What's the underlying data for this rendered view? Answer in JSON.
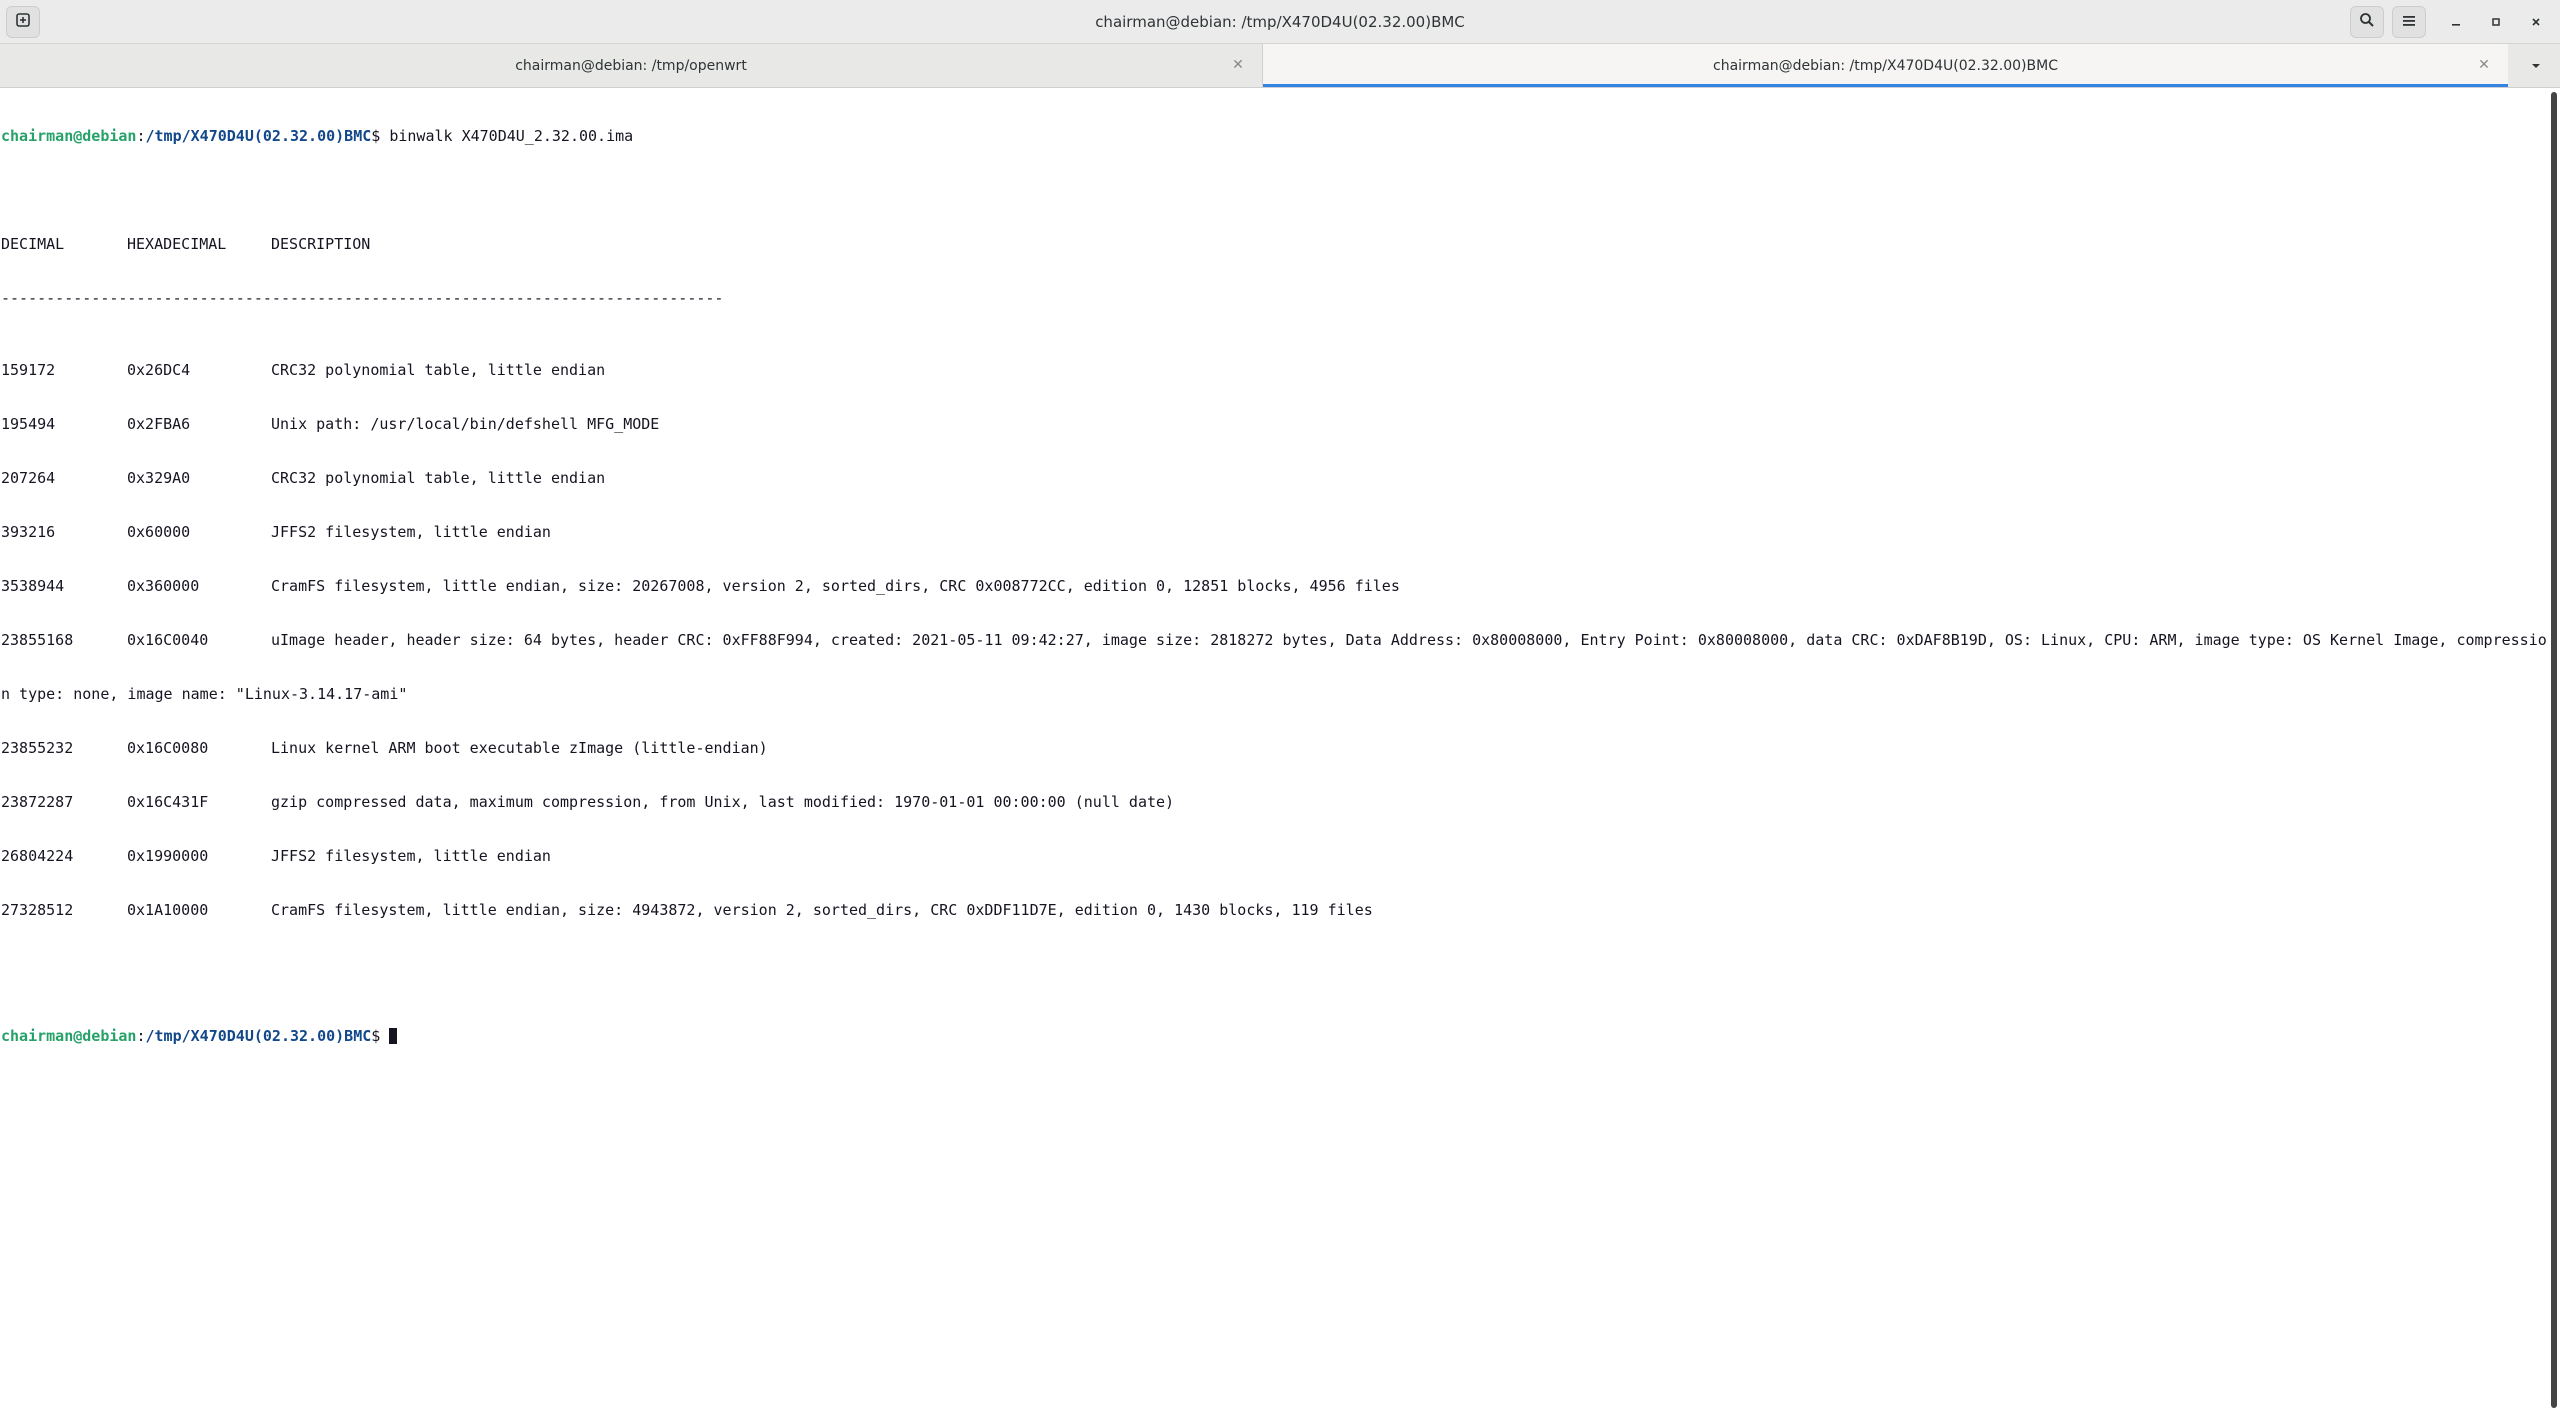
{
  "window": {
    "title": "chairman@debian: /tmp/X470D4U(02.32.00)BMC"
  },
  "header": {
    "new_tab_icon": "new-tab-icon",
    "search_icon": "search-icon",
    "menu_icon": "hamburger-menu-icon"
  },
  "tabs": [
    {
      "label": "chairman@debian: /tmp/openwrt",
      "active": false
    },
    {
      "label": "chairman@debian: /tmp/X470D4U(02.32.00)BMC",
      "active": true
    }
  ],
  "colors": {
    "accent": "#3584e4",
    "prompt_user": "#26a269",
    "prompt_path": "#12488b"
  },
  "terminal": {
    "prompt_user": "chairman@debian",
    "prompt_sep": ":",
    "prompt_path": "/tmp/X470D4U(02.32.00)BMC",
    "prompt_dollar": "$ ",
    "command": "binwalk X470D4U_2.32.00.ima",
    "headers": [
      "DECIMAL",
      "HEXADECIMAL",
      "DESCRIPTION"
    ],
    "separator": "--------------------------------------------------------------------------------",
    "rows": [
      {
        "decimal": "159172",
        "hex": "0x26DC4",
        "description": "CRC32 polynomial table, little endian"
      },
      {
        "decimal": "195494",
        "hex": "0x2FBA6",
        "description": "Unix path: /usr/local/bin/defshell MFG_MODE"
      },
      {
        "decimal": "207264",
        "hex": "0x329A0",
        "description": "CRC32 polynomial table, little endian"
      },
      {
        "decimal": "393216",
        "hex": "0x60000",
        "description": "JFFS2 filesystem, little endian"
      },
      {
        "decimal": "3538944",
        "hex": "0x360000",
        "description": "CramFS filesystem, little endian, size: 20267008, version 2, sorted_dirs, CRC 0x008772CC, edition 0, 12851 blocks, 4956 files"
      },
      {
        "decimal": "23855168",
        "hex": "0x16C0040",
        "description": "uImage header, header size: 64 bytes, header CRC: 0xFF88F994, created: 2021-05-11 09:42:27, image size: 2818272 bytes, Data Address: 0x80008000, Entry Point: 0x80008000, data CRC: 0xDAF8B19D, OS: Linux, CPU: ARM, image type: OS Kernel Image, compressio"
      },
      {
        "decimal": "",
        "hex": "",
        "description": "",
        "wrap": "n type: none, image name: \"Linux-3.14.17-ami\""
      },
      {
        "decimal": "23855232",
        "hex": "0x16C0080",
        "description": "Linux kernel ARM boot executable zImage (little-endian)"
      },
      {
        "decimal": "23872287",
        "hex": "0x16C431F",
        "description": "gzip compressed data, maximum compression, from Unix, last modified: 1970-01-01 00:00:00 (null date)"
      },
      {
        "decimal": "26804224",
        "hex": "0x1990000",
        "description": "JFFS2 filesystem, little endian"
      },
      {
        "decimal": "27328512",
        "hex": "0x1A10000",
        "description": "CramFS filesystem, little endian, size: 4943872, version 2, sorted_dirs, CRC 0xDDF11D7E, edition 0, 1430 blocks, 119 files"
      }
    ]
  }
}
